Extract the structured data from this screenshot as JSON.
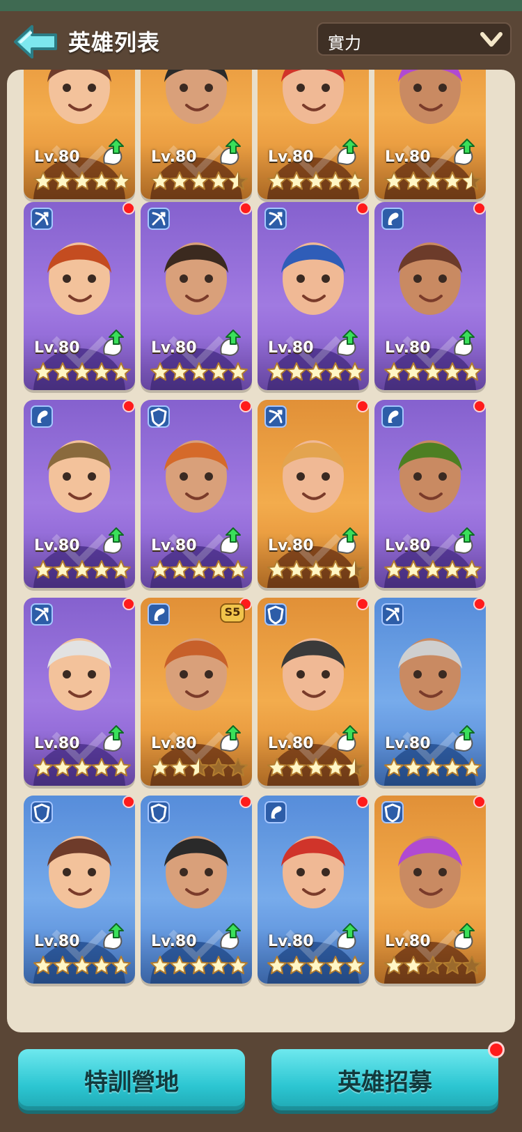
{
  "header": {
    "title": "英雄列表"
  },
  "sort": {
    "selected": "實力"
  },
  "cards": [
    {
      "level": "Lv.80",
      "color": "orange",
      "stars": 5
    },
    {
      "level": "Lv.80",
      "color": "orange",
      "stars": 4.5
    },
    {
      "level": "Lv.80",
      "color": "orange",
      "stars": 5
    },
    {
      "level": "Lv.80",
      "color": "orange",
      "stars": 4.5
    },
    {
      "level": "Lv.80",
      "color": "purple",
      "stars": 5,
      "class_icon": "bow-icon"
    },
    {
      "level": "Lv.80",
      "color": "purple",
      "stars": 5,
      "class_icon": "bow-icon"
    },
    {
      "level": "Lv.80",
      "color": "purple",
      "stars": 5,
      "class_icon": "bow-icon"
    },
    {
      "level": "Lv.80",
      "color": "purple",
      "stars": 5,
      "class_icon": "horse-icon"
    },
    {
      "level": "Lv.80",
      "color": "purple",
      "stars": 5,
      "class_icon": "horse-icon"
    },
    {
      "level": "Lv.80",
      "color": "purple",
      "stars": 5,
      "class_icon": "shield-icon"
    },
    {
      "level": "Lv.80",
      "color": "orange",
      "stars": 4.5,
      "class_icon": "bow-icon"
    },
    {
      "level": "Lv.80",
      "color": "purple",
      "stars": 5,
      "class_icon": "horse-icon"
    },
    {
      "level": "Lv.80",
      "color": "purple",
      "stars": 5,
      "class_icon": "bow-icon"
    },
    {
      "level": "Lv.80",
      "color": "orange",
      "stars": 2.5,
      "class_icon": "horse-icon",
      "badge": "S5"
    },
    {
      "level": "Lv.80",
      "color": "orange",
      "stars": 4.5,
      "class_icon": "shield-icon"
    },
    {
      "level": "Lv.80",
      "color": "blue",
      "stars": 5,
      "class_icon": "bow-icon"
    },
    {
      "level": "Lv.80",
      "color": "blue",
      "stars": 5,
      "class_icon": "shield-icon"
    },
    {
      "level": "Lv.80",
      "color": "blue",
      "stars": 5,
      "class_icon": "shield-icon"
    },
    {
      "level": "Lv.80",
      "color": "blue",
      "stars": 5,
      "class_icon": "horse-icon"
    },
    {
      "level": "Lv.80",
      "color": "orange",
      "stars": 2,
      "class_icon": "shield-icon"
    }
  ],
  "buttons": {
    "left": "特訓營地",
    "right": "英雄招募"
  }
}
